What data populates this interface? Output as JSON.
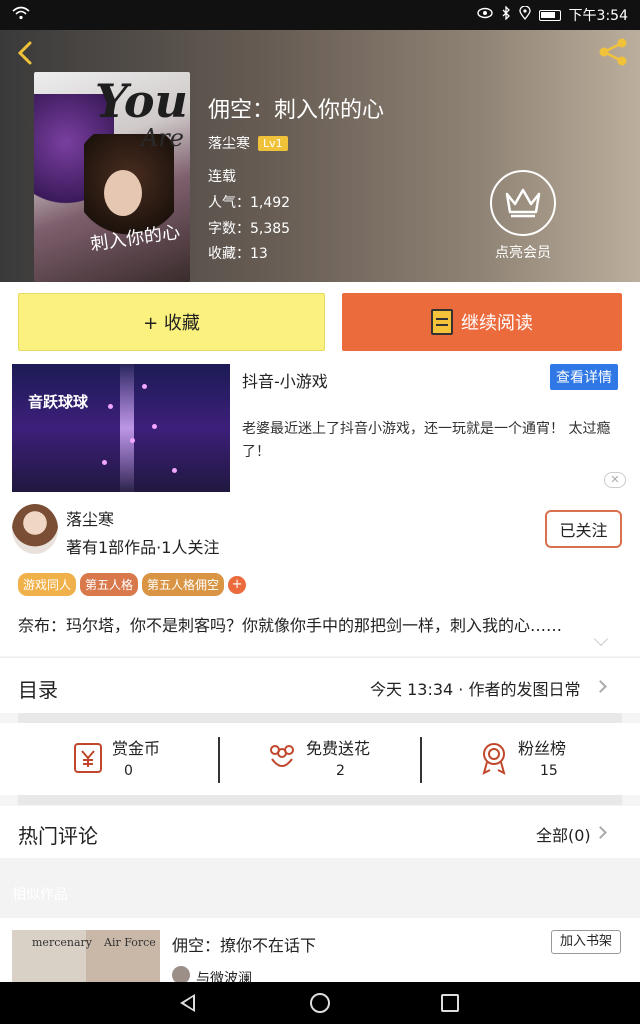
{
  "status_bar": {
    "time": "下午3:54"
  },
  "book": {
    "title": "佣空：刺入你的心",
    "author": "落尘寒",
    "level": "Lv1",
    "status": "连载",
    "popularity": "人气：1,492",
    "word_count": "字数：5,385",
    "favorites": "收藏：13",
    "cover_text_big": "You",
    "cover_text_mid": "Are",
    "cover_text_title": "刺入你的心"
  },
  "vip": {
    "label": "点亮会员"
  },
  "actions": {
    "collect_label": "+ 收藏",
    "read_label": "继续阅读"
  },
  "ad": {
    "title": "抖音-小游戏",
    "detail_label": "查看详情",
    "description": "老婆最近迷上了抖音小游戏，还一玩就是一个通宵！ 太过瘾了！",
    "image_logo": "音跃球球",
    "close_label": "✕"
  },
  "author_block": {
    "name": "落尘寒",
    "info": "著有1部作品·1人关注",
    "follow_label": "已关注",
    "tags": [
      "游戏同人",
      "第五人格",
      "第五人格佣空"
    ],
    "tag_add": "+",
    "synopsis": "奈布：玛尔塔，你不是刺客吗？你就像你手中的那把剑一样，刺入我的心……"
  },
  "toc": {
    "label": "目录",
    "update": "今天 13:34 · 作者的发图日常"
  },
  "stats": [
    {
      "name": "赏金币",
      "value": "0",
      "icon": "reward-coin-icon"
    },
    {
      "name": "免费送花",
      "value": "2",
      "icon": "flower-icon"
    },
    {
      "name": "粉丝榜",
      "value": "15",
      "icon": "medal-icon"
    }
  ],
  "comments": {
    "label": "热门评论",
    "all_label": "全部(0)"
  },
  "similar": {
    "label": "相似作品"
  },
  "recommended": {
    "title": "佣空：撩你不在话下",
    "add_label": "加入书架",
    "author": "与微波澜",
    "cover_left": "mercenary",
    "cover_right": "Air Force"
  },
  "colors": {
    "accent": "#ec6b3d",
    "collect": "#fbf17f",
    "link": "#2f78e6",
    "vip": "#f0c23a"
  }
}
